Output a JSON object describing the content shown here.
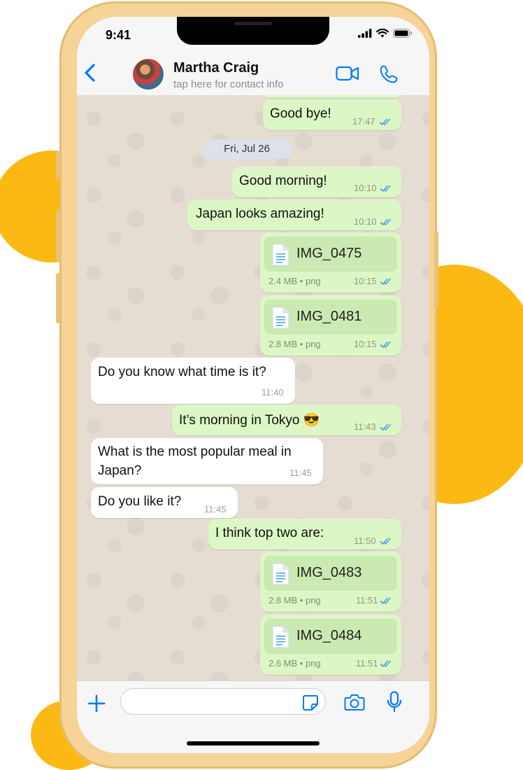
{
  "status_bar": {
    "time": "9:41"
  },
  "header": {
    "contact_name": "Martha Craig",
    "contact_subtitle": "tap here for contact info"
  },
  "colors": {
    "accent": "#007AFF",
    "outgoing_bubble": "#DCF7C5",
    "incoming_bubble": "#FFFFFF",
    "read_ticks": "#4FA3E0",
    "background_blob": "#FDB913"
  },
  "chat": {
    "date_separator": "Fri, Jul 26",
    "messages": [
      {
        "type": "text",
        "direction": "out",
        "text": "Good bye!",
        "time": "17:47",
        "read": true
      },
      {
        "type": "text",
        "direction": "out",
        "text": "Good morning!",
        "time": "10:10",
        "read": true
      },
      {
        "type": "text",
        "direction": "out",
        "text": "Japan looks amazing!",
        "time": "10:10",
        "read": true
      },
      {
        "type": "file",
        "direction": "out",
        "file_name": "IMG_0475",
        "meta": "2.4 MB • png",
        "time": "10:15",
        "read": true
      },
      {
        "type": "file",
        "direction": "out",
        "file_name": "IMG_0481",
        "meta": "2.8 MB • png",
        "time": "10:15",
        "read": true
      },
      {
        "type": "text",
        "direction": "in",
        "text": "Do you know what time is it?",
        "time": "11:40"
      },
      {
        "type": "text",
        "direction": "out",
        "text": "It’s morning in Tokyo 😎",
        "time": "11:43",
        "read": true
      },
      {
        "type": "text",
        "direction": "in",
        "text": "What is the most popular meal in Japan?",
        "time": "11:45"
      },
      {
        "type": "text",
        "direction": "in",
        "text": "Do you like it?",
        "time": "11:45"
      },
      {
        "type": "text",
        "direction": "out",
        "text": "I think top two are:",
        "time": "11:50",
        "read": true
      },
      {
        "type": "file",
        "direction": "out",
        "file_name": "IMG_0483",
        "meta": "2.8 MB • png",
        "time": "11:51",
        "read": true
      },
      {
        "type": "file",
        "direction": "out",
        "file_name": "IMG_0484",
        "meta": "2.6 MB • png",
        "time": "11:51",
        "read": true
      }
    ]
  },
  "input_bar": {
    "message_value": "",
    "icons": [
      "plus-icon",
      "sticker-icon",
      "camera-icon",
      "microphone-icon"
    ]
  },
  "icons": {
    "back": "chevron-left-icon",
    "video": "video-camera-icon",
    "call": "phone-icon",
    "file": "document-icon",
    "read": "double-check-icon"
  }
}
